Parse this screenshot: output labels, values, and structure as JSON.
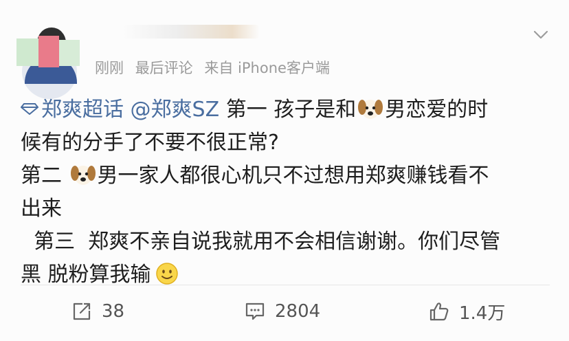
{
  "post": {
    "meta": {
      "time": "刚刚",
      "label": "最后评论",
      "source": "来自 iPhone客户端"
    },
    "content": {
      "topic_link": "郑爽超话",
      "mention_link": "@郑爽SZ",
      "line1_text": " 第一 孩子是和",
      "line1_tail": "男恋爱的时",
      "line2": "候有的分手了不要不很正常?",
      "line3_head": "第二 ",
      "line3_tail": "男一家人都很心机只不过想用郑爽赚钱看不",
      "line4": "出来",
      "line5": "  第三  郑爽不亲自说我就用不会相信谢谢。你们尽管",
      "line6": "黑 脱粉算我输"
    },
    "actions": {
      "repost_count": "38",
      "comment_count": "2804",
      "like_count": "1.4万"
    },
    "icons": [
      "chevron-down-icon",
      "topic-diamond-icon",
      "dog-emoji-icon",
      "smile-emoji-icon",
      "repost-icon",
      "comment-icon",
      "like-icon"
    ],
    "colors": {
      "link": "#4a6ea0",
      "text": "#1e1e1e",
      "meta": "#9a9a9a"
    }
  }
}
